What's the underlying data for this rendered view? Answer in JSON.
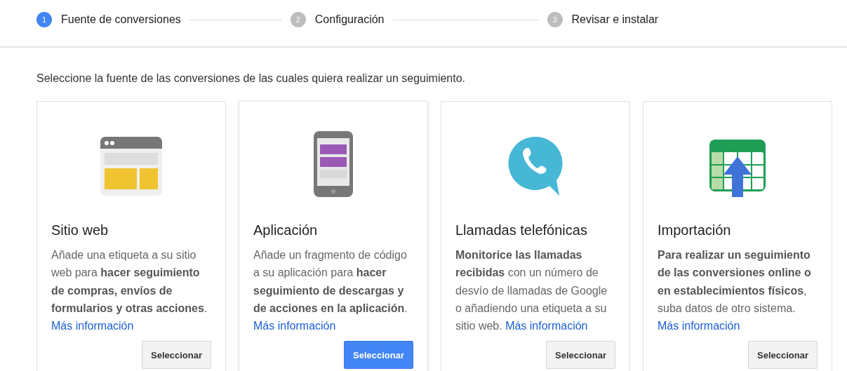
{
  "steps": [
    {
      "number": "1",
      "label": "Fuente de conversiones",
      "selected": true
    },
    {
      "number": "2",
      "label": "Configuración",
      "selected": false
    },
    {
      "number": "3",
      "label": "Revisar e instalar",
      "selected": false
    }
  ],
  "intro": "Seleccione la fuente de las conversiones de las cuales quiera realizar un seguimiento.",
  "sources": [
    {
      "kind": "web",
      "title": "Sitio web",
      "description": "Añade una etiqueta a su sitio web para **hacer seguimiento de compras, envíos de formularios y otras acciones**.",
      "link": "Más información",
      "button": "Seleccionar",
      "selected": false
    },
    {
      "kind": "app",
      "title": "Aplicación",
      "description": "Añade un fragmento de código a su aplicación para **hacer seguimiento de descargas y de acciones en la aplicación**.",
      "link": "Más información",
      "button": "Seleccionar",
      "selected": true
    },
    {
      "kind": "phone",
      "title": "Llamadas telefónicas",
      "description": "**Monitorice las llamadas recibidas** con un número de desvío de llamadas de Google o añadiendo una etiqueta a su sitio web.",
      "link": "Más información",
      "button": "Seleccionar",
      "selected": false
    },
    {
      "kind": "import",
      "title": "Importación",
      "description": "**Para realizar un seguimiento de las conversiones online o en establecimientos físicos**, suba datos de otro sistema.",
      "link": "Más información",
      "button": "Seleccionar",
      "selected": false
    }
  ]
}
